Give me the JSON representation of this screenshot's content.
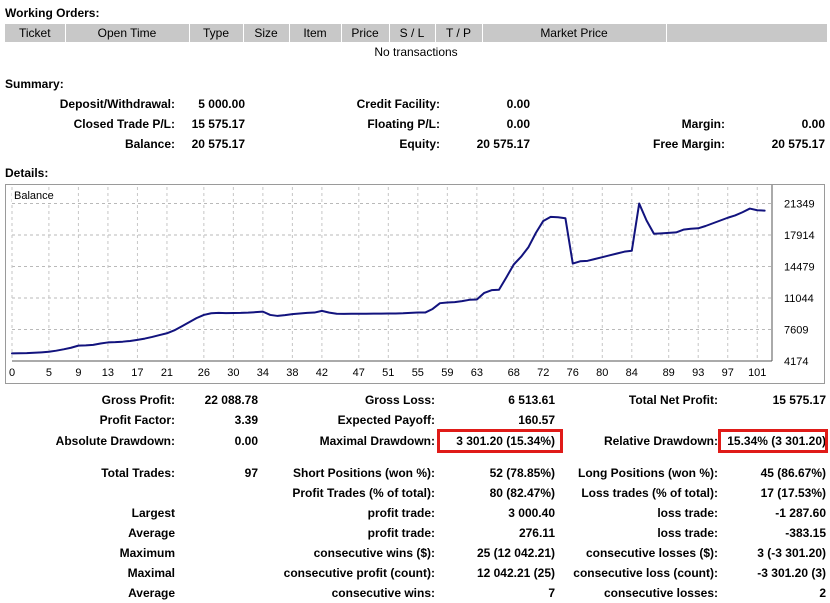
{
  "working_orders": {
    "title": "Working Orders:",
    "columns": [
      "Ticket",
      "Open Time",
      "Type",
      "Size",
      "Item",
      "Price",
      "S / L",
      "T / P",
      "Market Price",
      ""
    ],
    "empty_message": "No transactions"
  },
  "summary": {
    "title": "Summary:",
    "rows": [
      {
        "col1_label": "Deposit/Withdrawal:",
        "col1_value": "5 000.00",
        "col2_label": "Credit Facility:",
        "col2_value": "0.00",
        "col3_label": "",
        "col3_value": ""
      },
      {
        "col1_label": "Closed Trade P/L:",
        "col1_value": "15 575.17",
        "col2_label": "Floating P/L:",
        "col2_value": "0.00",
        "col3_label": "Margin:",
        "col3_value": "0.00"
      },
      {
        "col1_label": "Balance:",
        "col1_value": "20 575.17",
        "col2_label": "Equity:",
        "col2_value": "20 575.17",
        "col3_label": "Free Margin:",
        "col3_value": "20 575.17"
      }
    ]
  },
  "details": {
    "title": "Details:",
    "stats_rows": [
      {
        "col1_label": "Gross Profit:",
        "col1_value": "22 088.78",
        "col2_label": "Gross Loss:",
        "col2_value": "6 513.61",
        "col3_label": "Total Net Profit:",
        "col3_value": "15 575.17"
      },
      {
        "col1_label": "Profit Factor:",
        "col1_value": "3.39",
        "col2_label": "Expected Payoff:",
        "col2_value": "160.57",
        "col3_label": "",
        "col3_value": ""
      },
      {
        "col1_label": "Absolute Drawdown:",
        "col1_value": "0.00",
        "col2_label": "Maximal Drawdown:",
        "col2_value": "3 301.20 (15.34%)",
        "col3_label": "Relative Drawdown:",
        "col3_value": "15.34% (3 301.20)"
      },
      {
        "col1_label": "Total Trades:",
        "col1_value": "97",
        "col2_label": "Short Positions (won %):",
        "col2_value": "52 (78.85%)",
        "col3_label": "Long Positions (won %):",
        "col3_value": "45 (86.67%)"
      },
      {
        "col1_label": "",
        "col1_value": "",
        "col2_label": "Profit Trades (% of total):",
        "col2_value": "80 (82.47%)",
        "col3_label": "Loss trades (% of total):",
        "col3_value": "17 (17.53%)"
      },
      {
        "col1_label": "Largest",
        "col1_value": "",
        "col2_label": "profit trade:",
        "col2_value": "3 000.40",
        "col3_label": "loss trade:",
        "col3_value": "-1 287.60"
      },
      {
        "col1_label": "Average",
        "col1_value": "",
        "col2_label": "profit trade:",
        "col2_value": "276.11",
        "col3_label": "loss trade:",
        "col3_value": "-383.15"
      },
      {
        "col1_label": "Maximum",
        "col1_value": "",
        "col2_label": "consecutive wins ($):",
        "col2_value": "25 (12 042.21)",
        "col3_label": "consecutive losses ($):",
        "col3_value": "3 (-3 301.20)"
      },
      {
        "col1_label": "Maximal",
        "col1_value": "",
        "col2_label": "consecutive profit (count):",
        "col2_value": "12 042.21 (25)",
        "col3_label": "consecutive loss (count):",
        "col3_value": "-3 301.20 (3)"
      },
      {
        "col1_label": "Average",
        "col1_value": "",
        "col2_label": "consecutive wins:",
        "col2_value": "7",
        "col3_label": "consecutive losses:",
        "col3_value": "2"
      }
    ]
  },
  "highlights": {
    "color": "#e01b18",
    "targets": [
      "Maximal Drawdown value",
      "Relative Drawdown value"
    ]
  },
  "chart_data": {
    "type": "line",
    "title": "Balance",
    "legend_label": "Balance",
    "legend_position": "top-left",
    "xlabel": "",
    "ylabel": "",
    "grid": true,
    "line_color": "#12137e",
    "xlim": [
      0,
      103
    ],
    "ylim": [
      4174,
      22500
    ],
    "ytick_labels": [
      "21349",
      "17914",
      "14479",
      "11044",
      "7609",
      "4174"
    ],
    "yticks": [
      21349,
      17914,
      14479,
      11044,
      7609,
      4174
    ],
    "xtick_labels": [
      "0",
      "5",
      "9",
      "13",
      "17",
      "21",
      "26",
      "30",
      "34",
      "38",
      "42",
      "47",
      "51",
      "55",
      "59",
      "63",
      "68",
      "72",
      "76",
      "80",
      "84",
      "89",
      "93",
      "97",
      "101"
    ],
    "xticks": [
      0,
      5,
      9,
      13,
      17,
      21,
      26,
      30,
      34,
      38,
      42,
      47,
      51,
      55,
      59,
      63,
      68,
      72,
      76,
      80,
      84,
      89,
      93,
      97,
      101
    ],
    "series": [
      {
        "name": "Balance",
        "x": [
          0,
          2,
          4,
          5,
          6,
          7,
          8,
          9,
          10,
          11,
          12,
          13,
          14,
          15,
          16,
          17,
          18,
          19,
          20,
          21,
          22,
          23,
          24,
          25,
          26,
          27,
          28,
          29,
          30,
          31,
          32,
          33,
          34,
          35,
          36,
          37,
          38,
          39,
          40,
          41,
          42,
          43,
          44,
          45,
          46,
          47,
          48,
          49,
          50,
          51,
          52,
          53,
          54,
          55,
          56,
          57,
          58,
          59,
          60,
          61,
          62,
          63,
          64,
          65,
          66,
          67,
          68,
          69,
          70,
          71,
          72,
          73,
          74,
          75,
          76,
          77,
          78,
          79,
          80,
          81,
          82,
          83,
          84,
          85,
          86,
          87,
          88,
          89,
          90,
          91,
          92,
          93,
          94,
          95,
          96,
          97,
          98,
          99,
          100,
          101,
          102
        ],
        "y": [
          5000,
          5030,
          5120,
          5180,
          5300,
          5450,
          5620,
          5850,
          5880,
          5930,
          6080,
          6200,
          6230,
          6280,
          6360,
          6480,
          6620,
          6800,
          7000,
          7200,
          7520,
          7950,
          8400,
          8850,
          9200,
          9380,
          9420,
          9400,
          9410,
          9420,
          9450,
          9500,
          9560,
          9200,
          9090,
          9180,
          9290,
          9360,
          9420,
          9460,
          9640,
          9450,
          9330,
          9320,
          9325,
          9330,
          9335,
          9340,
          9345,
          9350,
          9360,
          9380,
          9420,
          9470,
          9460,
          9850,
          10480,
          10560,
          10600,
          10700,
          10850,
          10880,
          11600,
          11900,
          11950,
          13300,
          14700,
          15550,
          16600,
          18150,
          19450,
          19900,
          19850,
          19750,
          14800,
          15050,
          15100,
          15300,
          15500,
          15700,
          15900,
          16100,
          16200,
          21349,
          19500,
          18050,
          18100,
          18150,
          18200,
          18500,
          18600,
          18650,
          18900,
          19200,
          19500,
          19800,
          20050,
          20400,
          20800,
          20620,
          20575
        ]
      }
    ]
  }
}
